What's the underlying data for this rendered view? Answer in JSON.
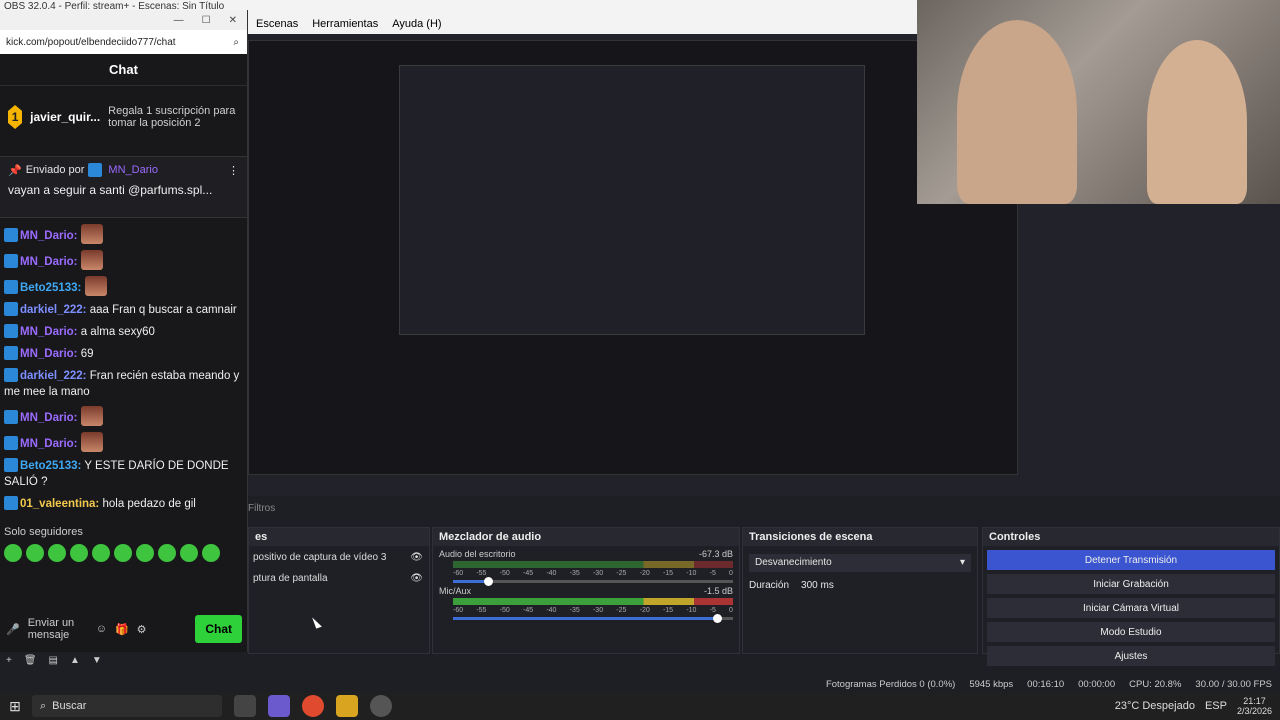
{
  "obs": {
    "window_title": "OBS 32.0.4 - Perfil: stream+ - Escenas: Sin Título",
    "menu": [
      "Escenas",
      "Herramientas",
      "Ayuda (H)"
    ]
  },
  "chat": {
    "url": "kick.com/popout/elbendeciido777/chat",
    "header": "Chat",
    "hype_user": "javier_quir...",
    "hype_count": "1",
    "gift_text": "Regala 1 suscripción para tomar la posición 2",
    "pinned_label": "Enviado por",
    "pinned_user": "MN_Dario",
    "pinned_text": "vayan a seguir a santi @parfums.spl...",
    "messages": [
      {
        "user": "MN_Dario:",
        "text": "",
        "cls": "u-mn",
        "emote": true
      },
      {
        "user": "MN_Dario:",
        "text": "",
        "cls": "u-mn",
        "emote": true
      },
      {
        "user": "Beto25133:",
        "text": "",
        "cls": "u-beto",
        "emote": true
      },
      {
        "user": "darkiel_222:",
        "text": "aaa Fran q buscar a camnair",
        "cls": "u-dark",
        "emote": false
      },
      {
        "user": "MN_Dario:",
        "text": "a alma sexy60",
        "cls": "u-mn",
        "emote": false
      },
      {
        "user": "MN_Dario:",
        "text": "69",
        "cls": "u-mn",
        "emote": false
      },
      {
        "user": "darkiel_222:",
        "text": "Fran recién estaba meando y me mee la mano",
        "cls": "u-dark",
        "emote": false
      },
      {
        "user": "MN_Dario:",
        "text": "",
        "cls": "u-mn",
        "emote": true
      },
      {
        "user": "MN_Dario:",
        "text": "",
        "cls": "u-mn",
        "emote": true
      },
      {
        "user": "Beto25133:",
        "text": "Y ESTE DARÍO DE DONDE SALIÓ ?",
        "cls": "u-beto",
        "emote": false
      },
      {
        "user": "01_valeentina:",
        "text": "hola pedazo de gil",
        "cls": "u-val",
        "emote": false
      }
    ],
    "followers_only": "Solo seguidores",
    "input_placeholder": "Enviar un mensaje",
    "chat_button": "Chat"
  },
  "docks": {
    "filters": "Filtros",
    "sources_title": "es",
    "sources": [
      "positivo de captura de vídeo 3",
      "ptura de pantalla"
    ],
    "mixer_title": "Mezclador de audio",
    "mixer": [
      {
        "name": "Audio del escritorio",
        "db": "-67.3 dB",
        "level": 0.0,
        "vol": 0.11
      },
      {
        "name": "Mic/Aux",
        "db": "-1.5 dB",
        "level": 0.82,
        "vol": 0.93
      }
    ],
    "ticks": [
      "-60",
      "-55",
      "-50",
      "-45",
      "-40",
      "-35",
      "-30",
      "-25",
      "-20",
      "-15",
      "-10",
      "-5",
      "0"
    ],
    "transitions_title": "Transiciones de escena",
    "transition": "Desvanecimiento",
    "duration_label": "Duración",
    "duration_value": "300 ms",
    "controls_title": "Controles",
    "controls": [
      "Detener Transmisión",
      "Iniciar Grabación",
      "Iniciar Cámara Virtual",
      "Modo Estudio",
      "Ajustes"
    ]
  },
  "status": {
    "dropped": "Fotogramas Perdidos 0 (0.0%)",
    "bitrate": "5945 kbps",
    "stream_time": "00:16:10",
    "rec_time": "00:00:00",
    "cpu": "CPU: 20.8%",
    "fps": "30.00 / 30.00 FPS"
  },
  "taskbar": {
    "search": "Buscar",
    "weather": "23°C Despejado",
    "lang": "ESP",
    "time": "21:17",
    "date": "2/3/2026"
  }
}
